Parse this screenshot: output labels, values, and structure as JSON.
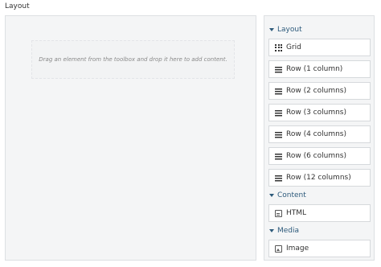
{
  "page": {
    "title": "Layout"
  },
  "canvas": {
    "placeholder": "Drag an element from the toolbox and drop it here to add content."
  },
  "toolbox": {
    "groups": [
      {
        "label": "Layout",
        "items": [
          {
            "label": "Grid",
            "icon": "grid-icon"
          },
          {
            "label": "Row (1 column)",
            "icon": "rows-icon"
          },
          {
            "label": "Row (2 columns)",
            "icon": "rows-icon"
          },
          {
            "label": "Row (3 columns)",
            "icon": "rows-icon"
          },
          {
            "label": "Row (4 columns)",
            "icon": "rows-icon"
          },
          {
            "label": "Row (6 columns)",
            "icon": "rows-icon"
          },
          {
            "label": "Row (12 columns)",
            "icon": "rows-icon"
          }
        ]
      },
      {
        "label": "Content",
        "items": [
          {
            "label": "HTML",
            "icon": "file-code-icon"
          }
        ]
      },
      {
        "label": "Media",
        "items": [
          {
            "label": "Image",
            "icon": "file-image-icon"
          }
        ]
      }
    ]
  }
}
